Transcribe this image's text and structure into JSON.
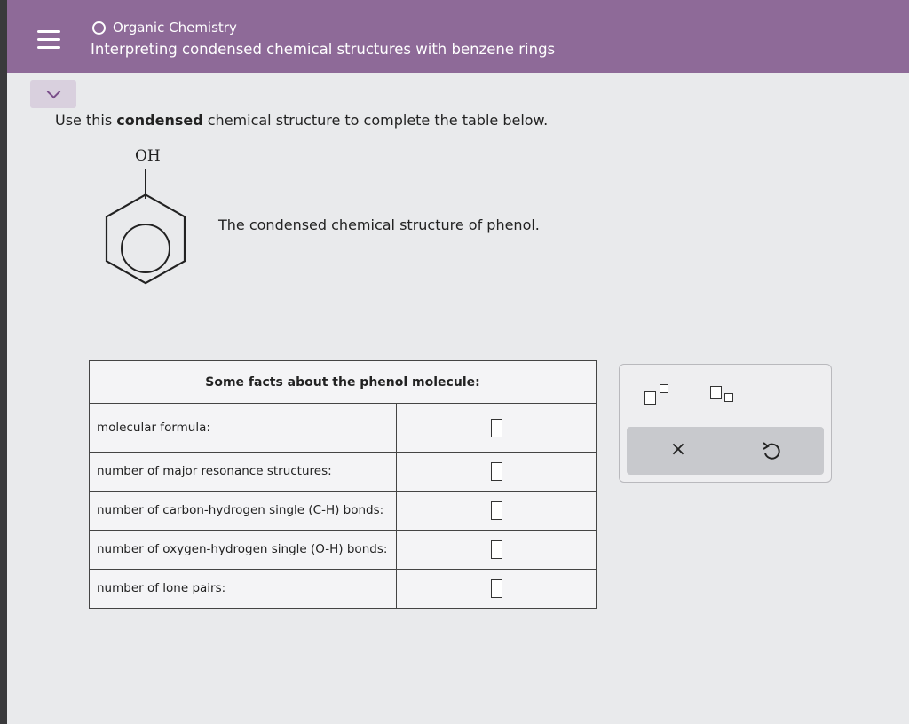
{
  "header": {
    "topic": "Organic Chemistry",
    "title": "Interpreting condensed chemical structures with benzene rings"
  },
  "instructions": {
    "prefix": "Use this",
    "bold": "condensed",
    "suffix": "chemical structure to complete the table below."
  },
  "molecule": {
    "substituent": "OH",
    "caption": "The condensed chemical structure of phenol."
  },
  "table": {
    "title": "Some facts about the phenol molecule:",
    "rows": [
      {
        "label": "molecular formula:",
        "answer": ""
      },
      {
        "label": "number of major resonance structures:",
        "answer": ""
      },
      {
        "label": "number of carbon-hydrogen single (C-H) bonds:",
        "answer": ""
      },
      {
        "label": "number of oxygen-hydrogen single (O-H) bonds:",
        "answer": ""
      },
      {
        "label": "number of lone pairs:",
        "answer": ""
      }
    ]
  },
  "tools": {
    "clear_symbol": "×"
  },
  "colors": {
    "header_bg": "#8e6a98",
    "page_bg": "#e9eaec",
    "accent": "#7a4e8a"
  }
}
